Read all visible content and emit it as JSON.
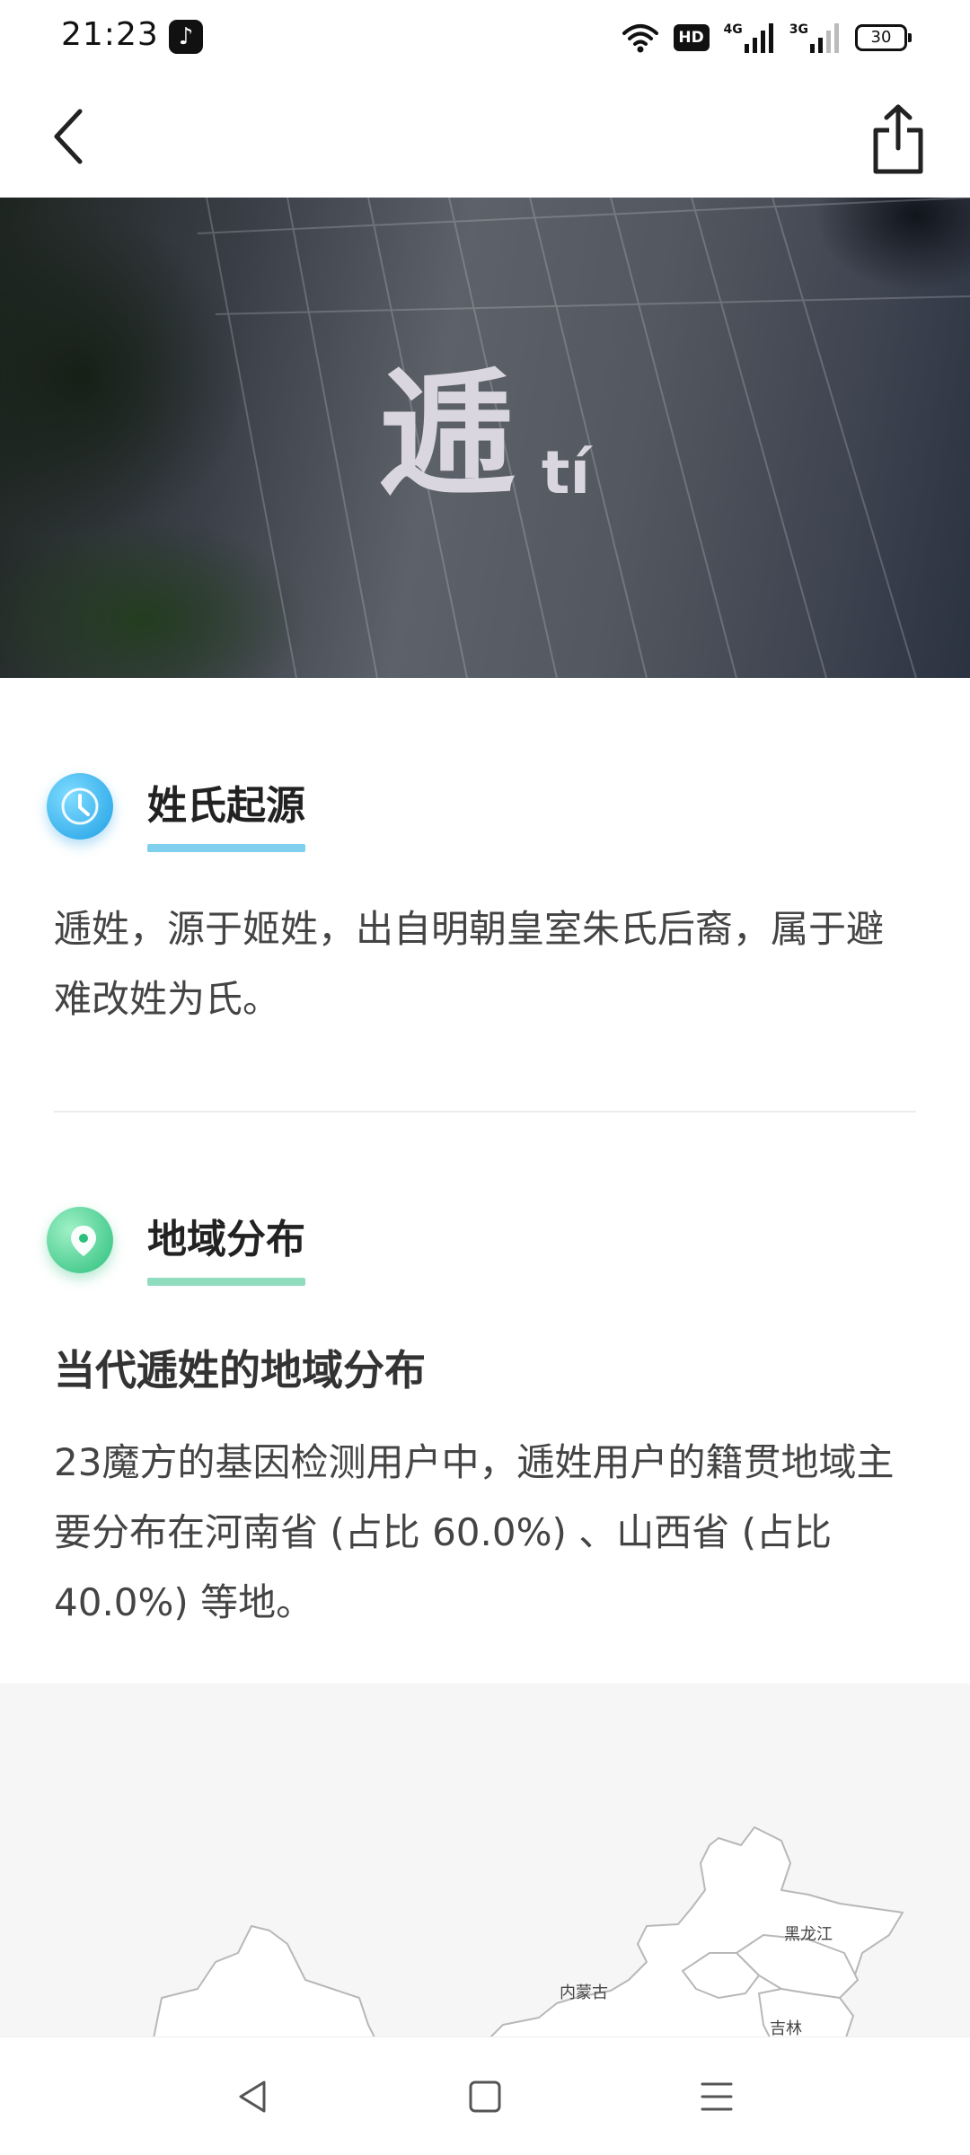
{
  "status_bar": {
    "time": "21:23",
    "app_icon": "tiktok-icon",
    "hd_label": "HD",
    "net1_label": "4G",
    "net2_label": "3G",
    "battery": "30"
  },
  "header": {
    "back_icon": "chevron-left-icon",
    "share_icon": "share-icon"
  },
  "hero": {
    "surname": "逓",
    "pinyin": "tí"
  },
  "origin": {
    "title": "姓氏起源",
    "icon": "clock-icon",
    "accent": "#7fd0ef",
    "text": "逓姓，源于姬姓，出自明朝皇室朱氏后裔，属于避难改姓为氏。"
  },
  "region": {
    "title": "地域分布",
    "icon": "location-pin-icon",
    "accent": "#8fdcbf",
    "subtitle": "当代逓姓的地域分布",
    "text": "23魔方的基因检测用户中，逓姓用户的籍贯地域主要分布在河南省 (占比 60.0%) 、山西省 (占比 40.0%) 等地。"
  },
  "map": {
    "labels": {
      "heilongjiang": "黑龙江",
      "neimenggu": "内蒙古",
      "jilin": "吉林"
    }
  },
  "nav": {
    "back": "triangle-back-icon",
    "home": "square-home-icon",
    "menu": "menu-lines-icon"
  }
}
